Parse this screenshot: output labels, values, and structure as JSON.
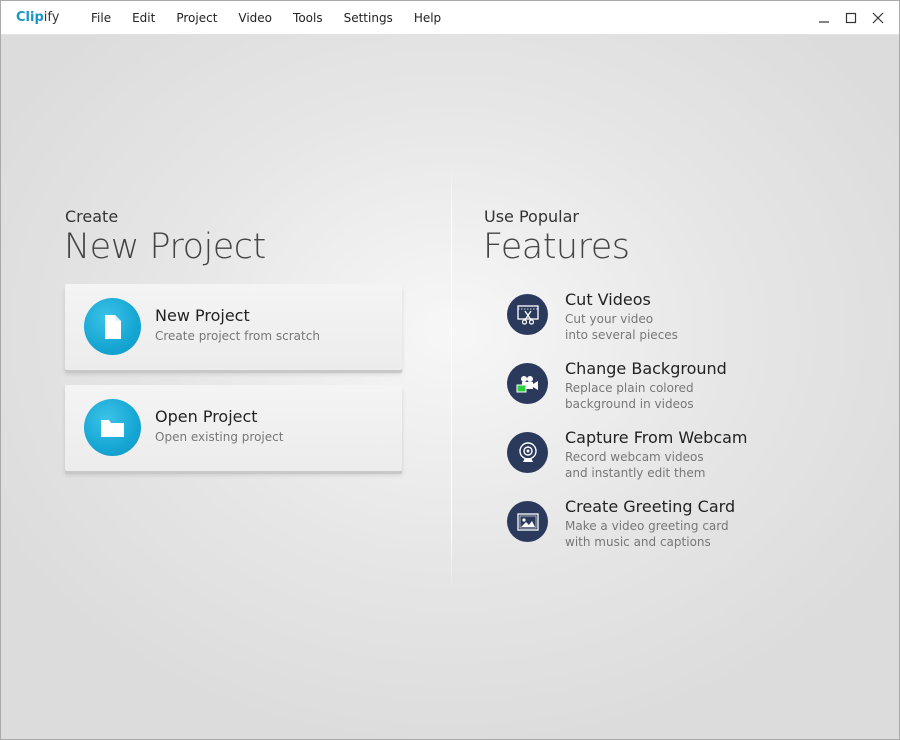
{
  "app": {
    "logo_part1": "Clip",
    "logo_part2": "ify"
  },
  "menu": [
    "File",
    "Edit",
    "Project",
    "Video",
    "Tools",
    "Settings",
    "Help"
  ],
  "window_controls": {
    "minimize_icon": "minimize-icon",
    "maximize_icon": "maximize-icon",
    "close_icon": "close-icon"
  },
  "left": {
    "small_heading": "Create",
    "big_heading": "New Project",
    "cards": [
      {
        "title": "New Project",
        "subtitle": "Create project from scratch",
        "icon": "document-icon"
      },
      {
        "title": "Open Project",
        "subtitle": "Open existing project",
        "icon": "folder-icon"
      }
    ]
  },
  "right": {
    "small_heading": "Use Popular",
    "big_heading": "Features",
    "features": [
      {
        "title": "Cut Videos",
        "line1": "Cut your video",
        "line2": "into several pieces",
        "icon": "scissors-film-icon"
      },
      {
        "title": "Change Background",
        "line1": "Replace plain colored",
        "line2": "background in videos",
        "icon": "chroma-camera-icon"
      },
      {
        "title": "Capture From Webcam",
        "line1": "Record webcam videos",
        "line2": "and instantly edit them",
        "icon": "webcam-icon"
      },
      {
        "title": "Create Greeting Card",
        "line1": "Make a video greeting card",
        "line2": "with music and captions",
        "icon": "picture-icon"
      }
    ]
  },
  "colors": {
    "accent": "#16a6d3",
    "feature_icon_bg": "#2b3a5c",
    "chroma_green": "#2ecc40"
  }
}
